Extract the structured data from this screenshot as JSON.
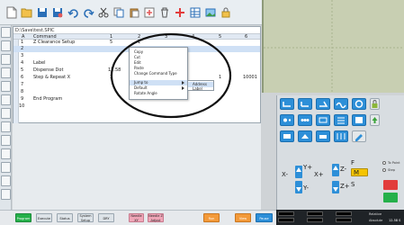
{
  "grid": {
    "file_path": "D:\\Save\\test.SPIC",
    "columns": [
      "A",
      "Command",
      "1",
      "2",
      "3",
      "4",
      "5",
      "6"
    ],
    "rows": [
      {
        "num": "1",
        "command": "Z Clearance Setup",
        "c1": "5",
        "c2": "",
        "c3": "1",
        "c4": "",
        "c5": "",
        "c6": ""
      },
      {
        "num": "2",
        "command": "",
        "c1": "",
        "c2": "",
        "c3": "",
        "c4": "",
        "c5": "",
        "c6": ""
      },
      {
        "num": "3",
        "command": "",
        "c1": "",
        "c2": "",
        "c3": "",
        "c4": "",
        "c5": "",
        "c6": ""
      },
      {
        "num": "4",
        "command": "Label",
        "c1": "",
        "c2": "",
        "c3": "",
        "c4": "",
        "c5": "",
        "c6": ""
      },
      {
        "num": "5",
        "command": "Dispense Dot",
        "c1": "12.58",
        "c2": "",
        "c3": "",
        "c4": "",
        "c5": "",
        "c6": ""
      },
      {
        "num": "6",
        "command": "Step & Repeat X",
        "c1": "3",
        "c2": "",
        "c3": "",
        "c4": "1",
        "c5": "",
        "c6": "10001"
      },
      {
        "num": "7",
        "command": "",
        "c1": "",
        "c2": "",
        "c3": "",
        "c4": "",
        "c5": "",
        "c6": ""
      },
      {
        "num": "8",
        "command": "",
        "c1": "",
        "c2": "",
        "c3": "",
        "c4": "",
        "c5": "",
        "c6": ""
      },
      {
        "num": "9",
        "command": "End Program",
        "c1": "",
        "c2": "",
        "c3": "",
        "c4": "",
        "c5": "",
        "c6": ""
      },
      {
        "num": "10",
        "command": "",
        "c1": "",
        "c2": "",
        "c3": "",
        "c4": "",
        "c5": "",
        "c6": ""
      }
    ]
  },
  "context_menu": {
    "items": [
      "Copy",
      "Cut",
      "Edit",
      "Paste",
      "Change Command Type",
      "Jump to",
      "Default",
      "Rotate Angle"
    ],
    "submenu": [
      "Address",
      "Label"
    ]
  },
  "jog": {
    "x_minus": "X-",
    "x_plus": "X+",
    "y_plus": "Y+",
    "y_minus": "Y-",
    "z_plus": "Z+",
    "z_minus": "Z-",
    "f_label": "F",
    "m_label": "M",
    "s_label": "S",
    "option_to_point": "To Point",
    "option_step": "Step"
  },
  "coords": {
    "relative": "Relative",
    "absolute": "Absolute",
    "value": "12.58 S"
  },
  "bottom": {
    "program": "Program",
    "execute": "Execute",
    "status": "Status",
    "system_setup": "System Setup",
    "dry": "DRY",
    "needle_xy": "Needle XY",
    "needle_z_adjust": "Needle Z Adjust",
    "run": "Run",
    "view": "View",
    "pause": "Pause"
  },
  "colors": {
    "accent": "#2d8fd8",
    "highlight": "#cfe0f5",
    "green": "#25b04a",
    "yellow": "#f5c400"
  }
}
